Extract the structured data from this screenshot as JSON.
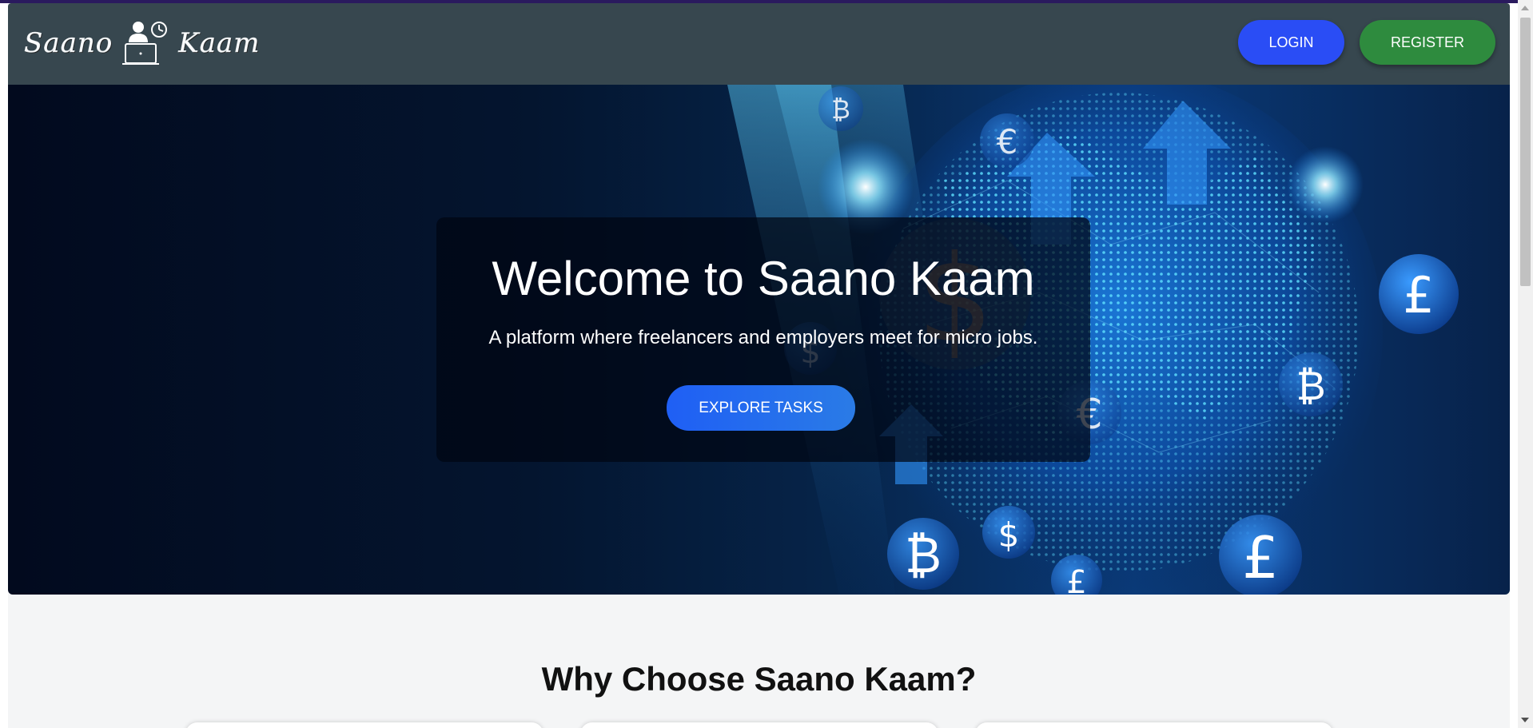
{
  "nav": {
    "logo_text_left": "Saano",
    "logo_text_right": "Kaam",
    "login_label": "LOGIN",
    "register_label": "REGISTER"
  },
  "hero": {
    "title": "Welcome to Saano Kaam",
    "subtitle": "A platform where freelancers and employers meet for micro jobs.",
    "cta_label": "EXPLORE TASKS",
    "background_icons": [
      "bitcoin-icon",
      "euro-icon",
      "dollar-icon",
      "pound-icon",
      "globe-icon"
    ]
  },
  "why": {
    "title": "Why Choose Saano Kaam?"
  },
  "colors": {
    "navbar": "#37474f",
    "login": "#2a4df5",
    "register": "#2e8b3e",
    "cta": "#1f5ff5",
    "hero_bg": "#04152f"
  }
}
